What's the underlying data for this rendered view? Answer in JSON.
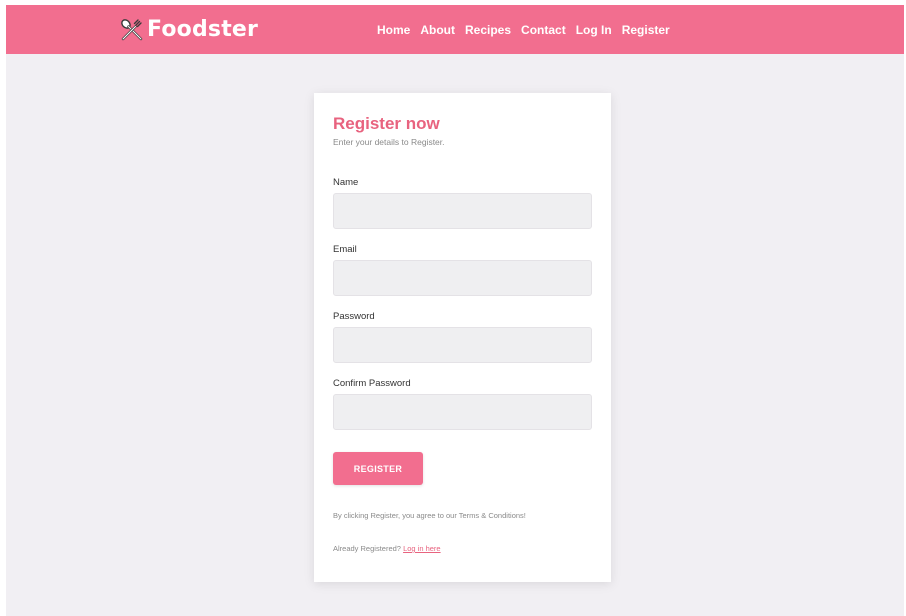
{
  "brand": {
    "name": "Foodster",
    "icon": "fork-spoon-icon"
  },
  "nav": {
    "items": [
      {
        "label": "Home"
      },
      {
        "label": "About"
      },
      {
        "label": "Recipes"
      },
      {
        "label": "Contact"
      },
      {
        "label": "Log In"
      },
      {
        "label": "Register"
      }
    ]
  },
  "form": {
    "title": "Register now",
    "subtitle": "Enter your details to Register.",
    "fields": {
      "name": {
        "label": "Name",
        "value": "",
        "placeholder": ""
      },
      "email": {
        "label": "Email",
        "value": "",
        "placeholder": ""
      },
      "password": {
        "label": "Password",
        "value": "",
        "placeholder": ""
      },
      "confirm_password": {
        "label": "Confirm Password",
        "value": "",
        "placeholder": ""
      }
    },
    "submit_label": "REGISTER",
    "terms_note": "By clicking Register, you agree to our Terms & Conditions!",
    "login_prompt": "Already Registered?",
    "login_link": "Log in here"
  },
  "colors": {
    "accent": "#f26e8f",
    "title": "#e8637f",
    "page_background": "#f1eff3",
    "input_background": "#efeff1"
  }
}
